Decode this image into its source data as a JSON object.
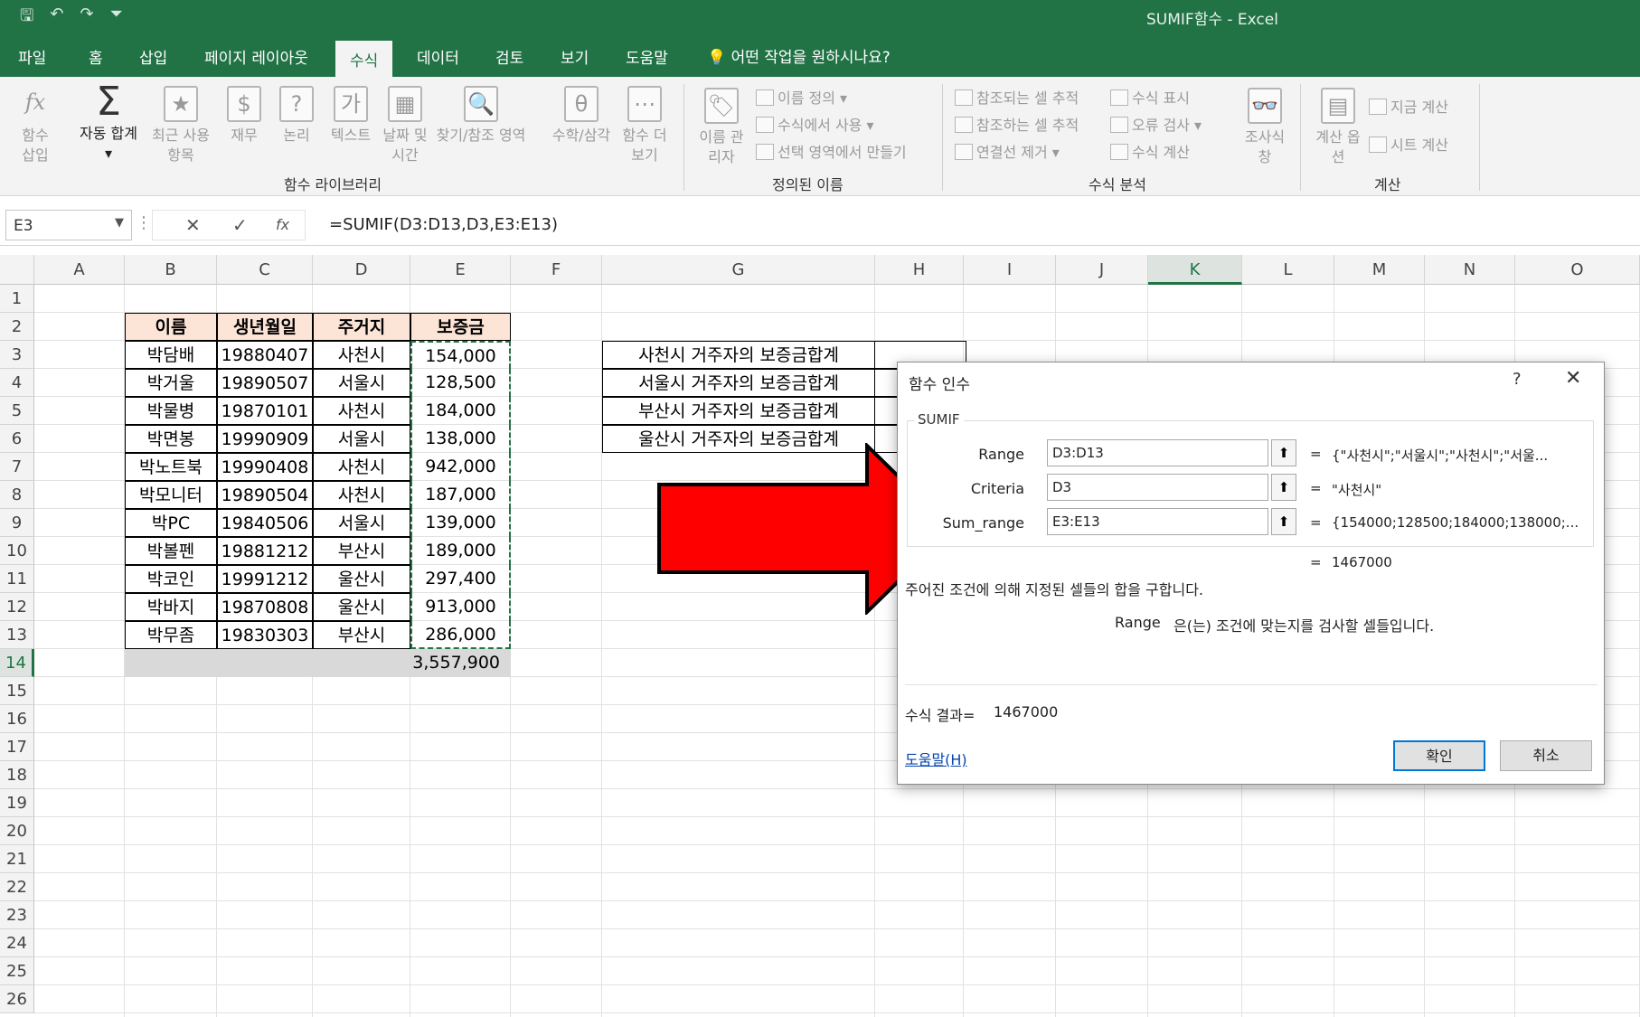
{
  "window": {
    "title": "SUMIF함수  -  Excel"
  },
  "qat": {
    "save": "🖫",
    "undo": "↶",
    "redo": "↷",
    "customize": "⏷"
  },
  "tabs": [
    "파일",
    "홈",
    "삽입",
    "페이지 레이아웃",
    "수식",
    "데이터",
    "검토",
    "보기",
    "도움말"
  ],
  "active_tab": "수식",
  "tell_me": "어떤 작업을 원하시나요?",
  "ribbon": {
    "library": {
      "label": "함수 라이브러리",
      "insert_function": "함수 삽입",
      "autosum": "자동 합계",
      "recent": "최근 사용 항목",
      "financial": "재무",
      "logical": "논리",
      "text": "텍스트",
      "datetime": "날짜 및 시간",
      "lookup": "찾기/참조 영역",
      "math": "수학/삼각",
      "more": "함수 더 보기"
    },
    "names": {
      "label": "정의된 이름",
      "manager": "이름 관리자",
      "define": "이름 정의",
      "use_in_formula": "수식에서 사용",
      "create_from_selection": "선택 영역에서 만들기"
    },
    "audit": {
      "label": "수식 분석",
      "trace_precedents": "참조되는 셀 추적",
      "trace_dependents": "참조하는 셀 추적",
      "remove_arrows": "연결선 제거",
      "show_formulas": "수식 표시",
      "error_checking": "오류 검사",
      "evaluate": "수식 계산",
      "watch": "조사식 창"
    },
    "calc": {
      "label": "계산",
      "options": "계산 옵션",
      "calc_now": "지금 계산",
      "calc_sheet": "시트 계산"
    }
  },
  "formula_bar": {
    "name_box": "E3",
    "formula": "=SUMIF(D3:D13,D3,E3:E13)",
    "cancel": "✕",
    "enter": "✓",
    "fx": "fx"
  },
  "columns": [
    "A",
    "B",
    "C",
    "D",
    "E",
    "F",
    "G",
    "H",
    "I",
    "J",
    "K",
    "L",
    "M",
    "N",
    "O"
  ],
  "rows": [
    "1",
    "2",
    "3",
    "4",
    "5",
    "6",
    "7",
    "8",
    "9",
    "10",
    "11",
    "12",
    "13",
    "14",
    "15",
    "16",
    "17",
    "18",
    "19",
    "20",
    "21",
    "22",
    "23",
    "24",
    "25",
    "26"
  ],
  "table": {
    "headers": [
      "이름",
      "생년월일",
      "주거지",
      "보증금"
    ],
    "rows": [
      [
        "박담배",
        "19880407",
        "사천시",
        "154,000"
      ],
      [
        "박거울",
        "19890507",
        "서울시",
        "128,500"
      ],
      [
        "박물병",
        "19870101",
        "사천시",
        "184,000"
      ],
      [
        "박면봉",
        "19990909",
        "서울시",
        "138,000"
      ],
      [
        "박노트북",
        "19990408",
        "사천시",
        "942,000"
      ],
      [
        "박모니터",
        "19890504",
        "사천시",
        "187,000"
      ],
      [
        "박PC",
        "19840506",
        "서울시",
        "139,000"
      ],
      [
        "박볼펜",
        "19881212",
        "부산시",
        "189,000"
      ],
      [
        "박코인",
        "19991212",
        "울산시",
        "297,400"
      ],
      [
        "박바지",
        "19870808",
        "울산시",
        "913,000"
      ],
      [
        "박무좀",
        "19830303",
        "부산시",
        "286,000"
      ]
    ],
    "total": "3,557,900"
  },
  "summary_labels": [
    "사천시 거주자의 보증금합계",
    "서울시 거주자의 보증금합계",
    "부산시 거주자의 보증금합계",
    "울산시 거주자의 보증금합계"
  ],
  "dialog": {
    "title": "함수 인수",
    "help_q": "?",
    "close": "✕",
    "function_name": "SUMIF",
    "args": [
      {
        "label": "Range",
        "value": "D3:D13",
        "result": "{\"사천시\";\"서울시\";\"사천시\";\"서울..."
      },
      {
        "label": "Criteria",
        "value": "D3",
        "result": "\"사천시\""
      },
      {
        "label": "Sum_range",
        "value": "E3:E13",
        "result": "{154000;128500;184000;138000;..."
      }
    ],
    "eq": "=",
    "computed": "1467000",
    "description": "주어진 조건에 의해 지정된 셀들의 합을 구합니다.",
    "arg_help_name": "Range",
    "arg_help_text": "은(는) 조건에 맞는지를 검사할 셀들입니다.",
    "result_label": "수식 결과=",
    "result_value": "1467000",
    "help_link": "도움말(H)",
    "ok": "확인",
    "cancel": "취소"
  },
  "colors": {
    "excel_green": "#217346",
    "header_fill": "#fce4d6",
    "arrow": "#ff0000"
  }
}
